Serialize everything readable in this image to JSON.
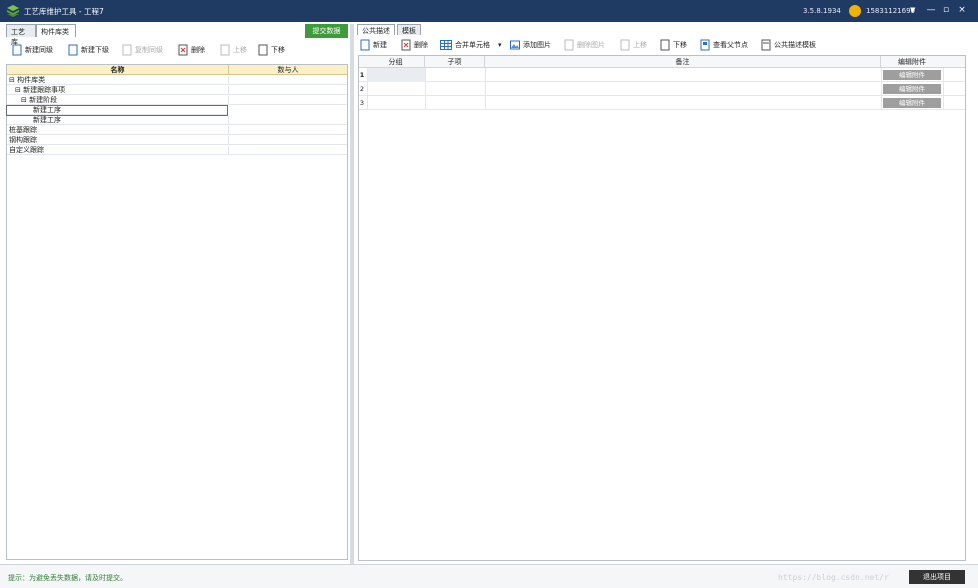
{
  "window": {
    "title": "工艺库维护工具 - 工程7",
    "version": "3.5.8.1934",
    "user": "15831121690",
    "dropdown": "▼",
    "minimize": "—",
    "restore": "▫",
    "close": "×"
  },
  "left": {
    "tabs": [
      "工艺库",
      "构件库类"
    ],
    "submit_label": "提交数据",
    "toolbar": [
      {
        "label": "新建同级",
        "disabled": false
      },
      {
        "label": "新建下级",
        "disabled": false
      },
      {
        "label": "复制同级",
        "disabled": true
      },
      {
        "label": "删除",
        "disabled": false
      },
      {
        "label": "上移",
        "disabled": true
      },
      {
        "label": "下移",
        "disabled": false
      }
    ],
    "columns": [
      "名称",
      "数与人"
    ],
    "rows": [
      {
        "name": "构件库类",
        "level": 0,
        "expand": "⊟"
      },
      {
        "name": "新建跟踪事项",
        "level": 1,
        "expand": "⊟"
      },
      {
        "name": "新建阶段",
        "level": 2,
        "expand": "⊟"
      },
      {
        "name": "新建工序",
        "level": 3,
        "expand": ""
      },
      {
        "name": "新建工序",
        "level": 3,
        "expand": ""
      },
      {
        "name": "桩基跟踪",
        "level": 0,
        "expand": ""
      },
      {
        "name": "钢构跟踪",
        "level": 0,
        "expand": ""
      },
      {
        "name": "自定义跟踪",
        "level": 0,
        "expand": ""
      }
    ]
  },
  "right": {
    "tabs": [
      "公共描述",
      "模板"
    ],
    "toolbar": [
      {
        "label": "新建",
        "disabled": false
      },
      {
        "label": "删除",
        "disabled": false
      },
      {
        "label": "合并单元格",
        "disabled": false
      },
      {
        "label": "▾",
        "disabled": false
      },
      {
        "label": "添加图片",
        "disabled": false
      },
      {
        "label": "删除图片",
        "disabled": true
      },
      {
        "label": "上移",
        "disabled": true
      },
      {
        "label": "下移",
        "disabled": false
      },
      {
        "label": "查看父节点",
        "disabled": false
      },
      {
        "label": "公共描述模板",
        "disabled": false
      }
    ],
    "columns": [
      "分组",
      "子项",
      "备注",
      "编辑附件"
    ],
    "rows": [
      {
        "no": "1",
        "attach": "编辑附件"
      },
      {
        "no": "2",
        "attach": "编辑附件"
      },
      {
        "no": "3",
        "attach": "编辑附件"
      }
    ]
  },
  "status": {
    "hint": "提示：为避免丢失数据，请及时提交。",
    "watermark": "https://blog.csdn.net/r",
    "exit_label": "退出项目"
  },
  "colors": {
    "titlebar": "#1f3a63",
    "submit": "#3e9a3a",
    "header_yellow": "#fbf0c6",
    "attach_button": "#9e9e9e"
  }
}
